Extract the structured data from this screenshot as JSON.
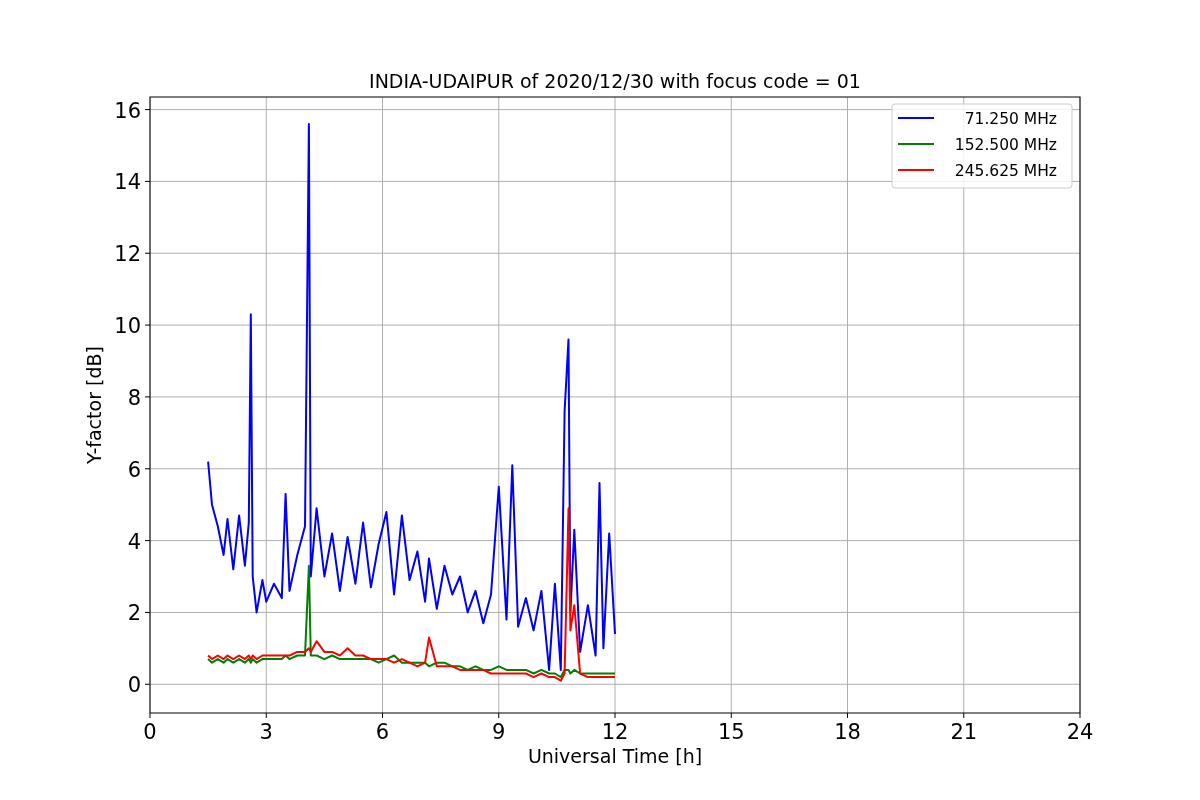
{
  "figure": {
    "chart_data": {
      "type": "line",
      "title": "INDIA-UDAIPUR of 2020/12/30 with focus code = 01",
      "xlabel": "Universal Time [h]",
      "ylabel": "Y-factor [dB]",
      "x": [
        1.5,
        1.6,
        1.75,
        1.9,
        2.0,
        2.15,
        2.3,
        2.45,
        2.55,
        2.6,
        2.65,
        2.75,
        2.9,
        3.0,
        3.2,
        3.4,
        3.5,
        3.6,
        3.8,
        4.0,
        4.1,
        4.15,
        4.3,
        4.5,
        4.7,
        4.9,
        5.1,
        5.3,
        5.5,
        5.7,
        5.9,
        6.1,
        6.3,
        6.5,
        6.7,
        6.9,
        7.1,
        7.2,
        7.4,
        7.6,
        7.8,
        8.0,
        8.2,
        8.4,
        8.6,
        8.8,
        9.0,
        9.2,
        9.35,
        9.5,
        9.7,
        9.9,
        10.1,
        10.3,
        10.45,
        10.6,
        10.7,
        10.8,
        10.85,
        10.95,
        11.1,
        11.3,
        11.5,
        11.6,
        11.7,
        11.85,
        12.0
      ],
      "series": [
        {
          "name": "71.250 MHz",
          "color": "#0000ff",
          "values": [
            6.2,
            5.0,
            4.4,
            3.6,
            4.6,
            3.2,
            4.7,
            3.3,
            4.5,
            10.3,
            3.0,
            2.0,
            2.9,
            2.3,
            2.8,
            2.4,
            5.3,
            2.6,
            3.6,
            4.4,
            15.6,
            3.0,
            4.9,
            3.0,
            4.2,
            2.6,
            4.1,
            2.8,
            4.5,
            2.7,
            3.9,
            4.8,
            2.5,
            4.7,
            2.9,
            3.7,
            2.3,
            3.5,
            2.1,
            3.3,
            2.5,
            3.0,
            2.0,
            2.6,
            1.7,
            2.5,
            5.5,
            1.8,
            6.1,
            1.6,
            2.4,
            1.5,
            2.6,
            0.4,
            2.8,
            0.4,
            7.6,
            9.6,
            2.0,
            4.3,
            0.9,
            2.2,
            0.8,
            5.6,
            1.0,
            4.2,
            1.4
          ]
        },
        {
          "name": "152.500 MHz",
          "color": "#008000",
          "values": [
            0.7,
            0.6,
            0.7,
            0.6,
            0.7,
            0.6,
            0.7,
            0.6,
            0.7,
            0.6,
            0.7,
            0.6,
            0.7,
            0.7,
            0.7,
            0.7,
            0.8,
            0.7,
            0.8,
            0.8,
            3.3,
            0.8,
            0.8,
            0.7,
            0.8,
            0.7,
            0.7,
            0.7,
            0.7,
            0.7,
            0.6,
            0.7,
            0.8,
            0.6,
            0.6,
            0.6,
            0.6,
            0.5,
            0.6,
            0.6,
            0.5,
            0.5,
            0.4,
            0.5,
            0.4,
            0.4,
            0.5,
            0.4,
            0.4,
            0.4,
            0.4,
            0.3,
            0.4,
            0.3,
            0.3,
            0.2,
            0.4,
            0.4,
            0.3,
            0.4,
            0.3,
            0.3,
            0.3,
            0.3,
            0.3,
            0.3,
            0.3
          ]
        },
        {
          "name": "245.625 MHz",
          "color": "#ff0000",
          "values": [
            0.8,
            0.7,
            0.8,
            0.7,
            0.8,
            0.7,
            0.8,
            0.7,
            0.8,
            0.7,
            0.8,
            0.7,
            0.8,
            0.8,
            0.8,
            0.8,
            0.8,
            0.8,
            0.9,
            0.9,
            1.0,
            0.9,
            1.2,
            0.9,
            0.9,
            0.8,
            1.0,
            0.8,
            0.8,
            0.7,
            0.7,
            0.7,
            0.6,
            0.7,
            0.6,
            0.5,
            0.6,
            1.3,
            0.5,
            0.5,
            0.5,
            0.4,
            0.4,
            0.4,
            0.4,
            0.3,
            0.3,
            0.3,
            0.3,
            0.3,
            0.3,
            0.2,
            0.3,
            0.2,
            0.2,
            0.1,
            0.3,
            4.9,
            1.5,
            2.2,
            0.3,
            0.2,
            0.2,
            0.2,
            0.2,
            0.2,
            0.2
          ]
        }
      ],
      "xlim": [
        0,
        24
      ],
      "ylim": [
        -0.8,
        16.35
      ],
      "grid": true,
      "legend": true,
      "xticks": [
        0,
        3,
        6,
        9,
        12,
        15,
        18,
        21,
        24
      ],
      "yticks": [
        0,
        2,
        4,
        6,
        8,
        10,
        12,
        14,
        16
      ]
    }
  }
}
